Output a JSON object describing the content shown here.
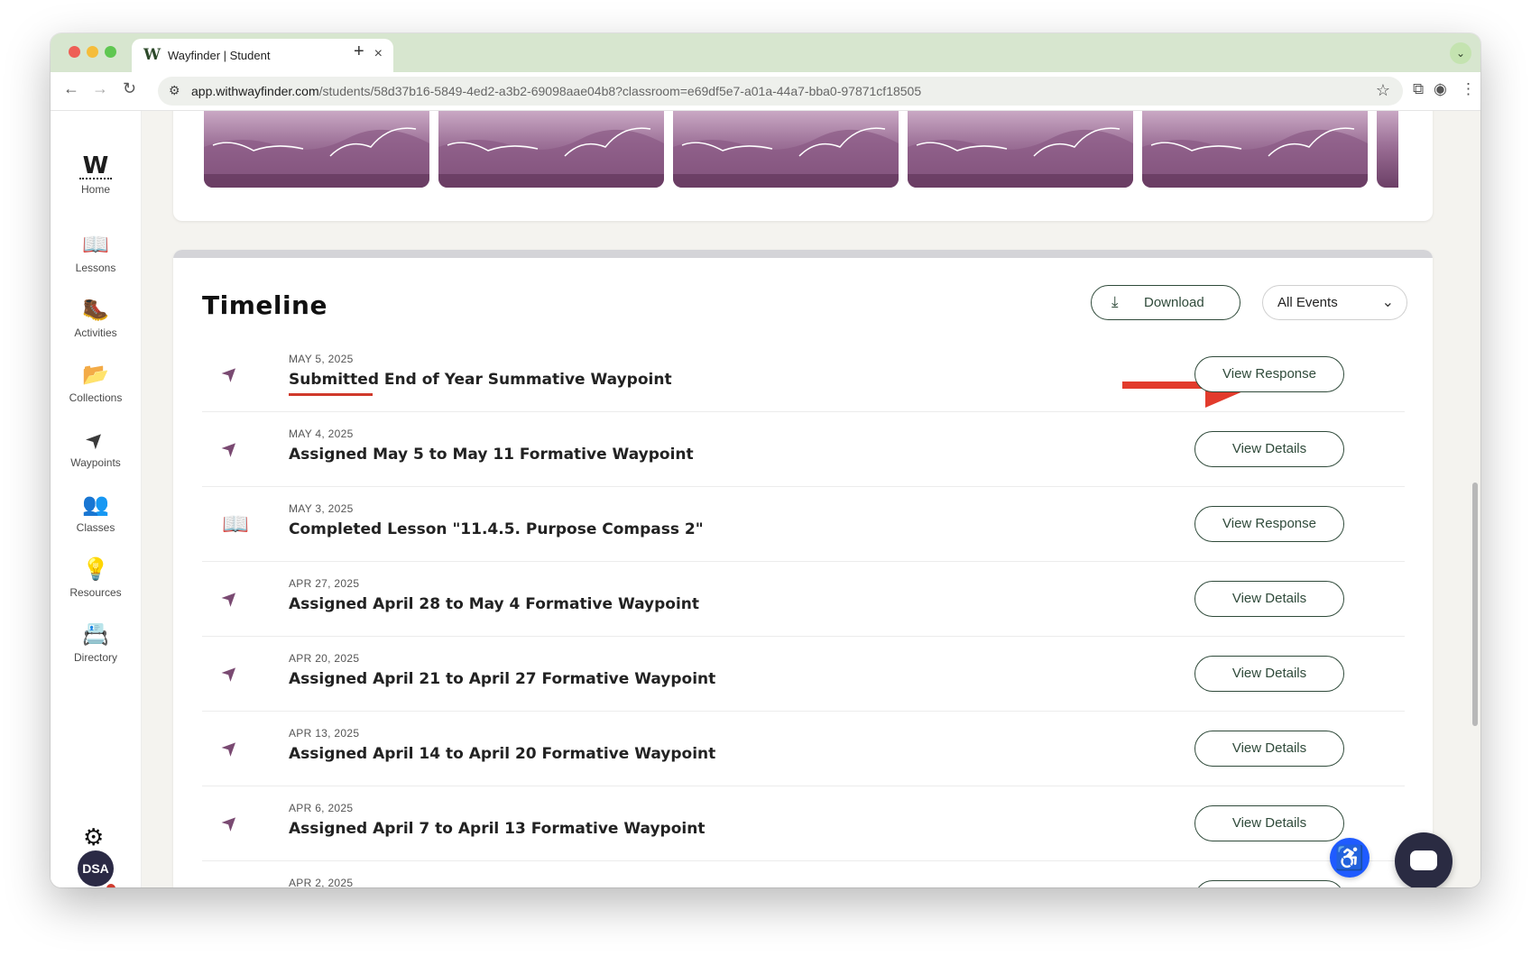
{
  "browser": {
    "tab_favicon": "W",
    "tab_title": "Wayfinder | Student",
    "tab_close": "×",
    "new_tab": "+",
    "tabs_menu": "⌄",
    "url_host": "app.withwayfinder.com",
    "url_path": "/students/58d37b16-5849-4ed2-a3b2-69098aae04b8?classroom=e69df5e7-a01a-44a7-bba0-97871cf18505",
    "icons": {
      "back": "←",
      "forward": "→",
      "reload": "↻",
      "site_info": "⚙",
      "star": "☆",
      "extensions": "⧉",
      "profile": "◉",
      "menu": "⋮"
    }
  },
  "sidebar": {
    "home": {
      "logo": "W",
      "label": "Home"
    },
    "items": [
      {
        "label": "Lessons",
        "icon": "📖"
      },
      {
        "label": "Activities",
        "icon": "🥾"
      },
      {
        "label": "Collections",
        "icon": "📂"
      },
      {
        "label": "Waypoints",
        "icon": "➤"
      },
      {
        "label": "Classes",
        "icon": "👥"
      },
      {
        "label": "Resources",
        "icon": "💡"
      },
      {
        "label": "Directory",
        "icon": "📇"
      }
    ],
    "settings_icon": "⚙",
    "avatar": "DSA"
  },
  "timeline": {
    "title": "Timeline",
    "download_label": "Download",
    "download_icon": "⤓",
    "filter_value": "All Events",
    "filter_chevron": "⌄",
    "rows": [
      {
        "date": "MAY 5, 2025",
        "text": "Submitted End of Year Summative Waypoint",
        "button": "View Response",
        "icon": "➤"
      },
      {
        "date": "MAY 4, 2025",
        "text": "Assigned May 5 to May 11 Formative Waypoint",
        "button": "View Details",
        "icon": "➤"
      },
      {
        "date": "MAY 3, 2025",
        "text": "Completed Lesson \"11.4.5. Purpose Compass 2\"",
        "button": "View Response",
        "icon": "📖"
      },
      {
        "date": "APR 27, 2025",
        "text": "Assigned April 28 to May 4 Formative Waypoint",
        "button": "View Details",
        "icon": "➤"
      },
      {
        "date": "APR 20, 2025",
        "text": "Assigned April 21 to April 27 Formative Waypoint",
        "button": "View Details",
        "icon": "➤"
      },
      {
        "date": "APR 13, 2025",
        "text": "Assigned April 14 to April 20 Formative Waypoint",
        "button": "View Details",
        "icon": "➤"
      },
      {
        "date": "APR 6, 2025",
        "text": "Assigned April 7 to April 13 Formative Waypoint",
        "button": "View Details",
        "icon": "➤"
      },
      {
        "date": "APR 2, 2025",
        "text": "",
        "button": "",
        "icon": ""
      }
    ]
  },
  "widgets": {
    "accessibility_icon": "♿"
  },
  "colors": {
    "brand_green": "#2f4a3a",
    "accent_red": "#d0392b",
    "plum": "#7a4a72",
    "tab_bar": "#d7e6cf"
  }
}
